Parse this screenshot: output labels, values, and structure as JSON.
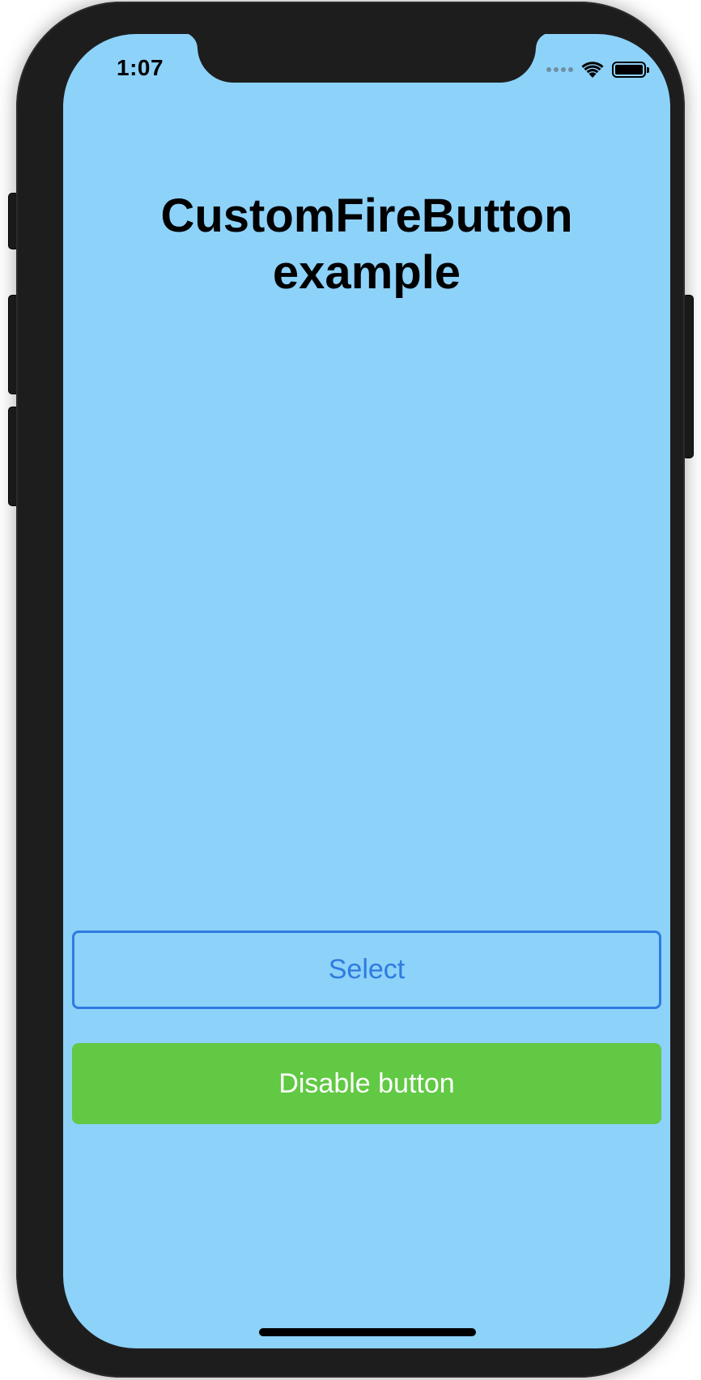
{
  "status_bar": {
    "time": "1:07",
    "icons": [
      "cellular-signal-icon",
      "wifi-icon",
      "battery-icon"
    ]
  },
  "main": {
    "title_line1": "CustomFireButton",
    "title_line2": "example"
  },
  "buttons": {
    "select_label": "Select",
    "disable_label": "Disable button"
  },
  "colors": {
    "screen_background": "#8dd2f9",
    "select_accent": "#2f7be0",
    "disable_background": "#61c943",
    "device_frame": "#1d1d1d"
  }
}
